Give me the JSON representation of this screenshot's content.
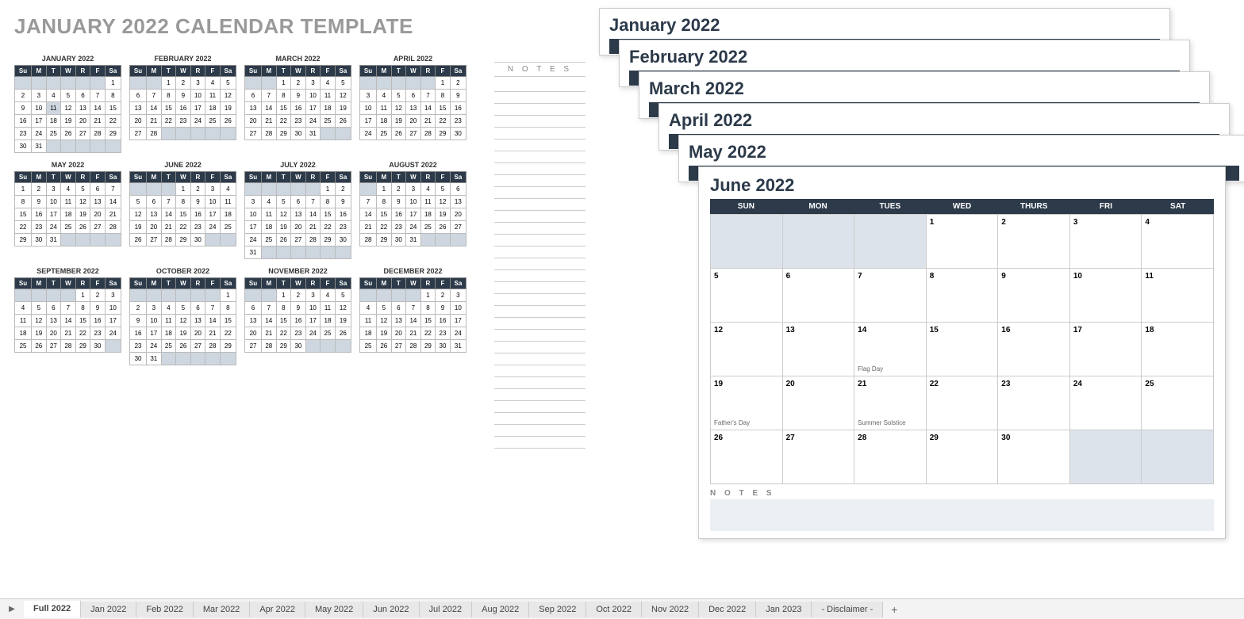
{
  "main_title": "JANUARY 2022 CALENDAR TEMPLATE",
  "notes_label": "N O T E S",
  "day_short": [
    "Su",
    "M",
    "T",
    "W",
    "R",
    "F",
    "Sa"
  ],
  "day_long": [
    "SUN",
    "MON",
    "TUES",
    "WED",
    "THURS",
    "FRI",
    "SAT"
  ],
  "months": [
    {
      "name": "JANUARY 2022",
      "start": 6,
      "days": 31,
      "hl": [
        11
      ]
    },
    {
      "name": "FEBRUARY 2022",
      "start": 2,
      "days": 28,
      "hl": []
    },
    {
      "name": "MARCH 2022",
      "start": 2,
      "days": 31,
      "hl": []
    },
    {
      "name": "APRIL 2022",
      "start": 5,
      "days": 30,
      "hl": []
    },
    {
      "name": "MAY 2022",
      "start": 0,
      "days": 31,
      "hl": []
    },
    {
      "name": "JUNE 2022",
      "start": 3,
      "days": 30,
      "hl": []
    },
    {
      "name": "JULY 2022",
      "start": 5,
      "days": 31,
      "hl": []
    },
    {
      "name": "AUGUST 2022",
      "start": 1,
      "days": 31,
      "hl": []
    },
    {
      "name": "SEPTEMBER 2022",
      "start": 4,
      "days": 30,
      "hl": []
    },
    {
      "name": "OCTOBER 2022",
      "start": 6,
      "days": 31,
      "hl": []
    },
    {
      "name": "NOVEMBER 2022",
      "start": 2,
      "days": 30,
      "hl": []
    },
    {
      "name": "DECEMBER 2022",
      "start": 4,
      "days": 31,
      "hl": []
    }
  ],
  "stacked_pages": [
    "January 2022",
    "February 2022",
    "March 2022",
    "April 2022",
    "May 2022"
  ],
  "june": {
    "title": "June 2022",
    "start": 3,
    "days": 30,
    "events": {
      "14": "Flag Day",
      "19": "Father's Day",
      "21": "Summer Solstice"
    },
    "notes_label": "N O T E S"
  },
  "tabs": [
    "Full 2022",
    "Jan 2022",
    "Feb 2022",
    "Mar 2022",
    "Apr 2022",
    "May 2022",
    "Jun 2022",
    "Jul 2022",
    "Aug 2022",
    "Sep 2022",
    "Oct 2022",
    "Nov 2022",
    "Dec 2022",
    "Jan 2023",
    "- Disclaimer -"
  ],
  "active_tab": 0
}
